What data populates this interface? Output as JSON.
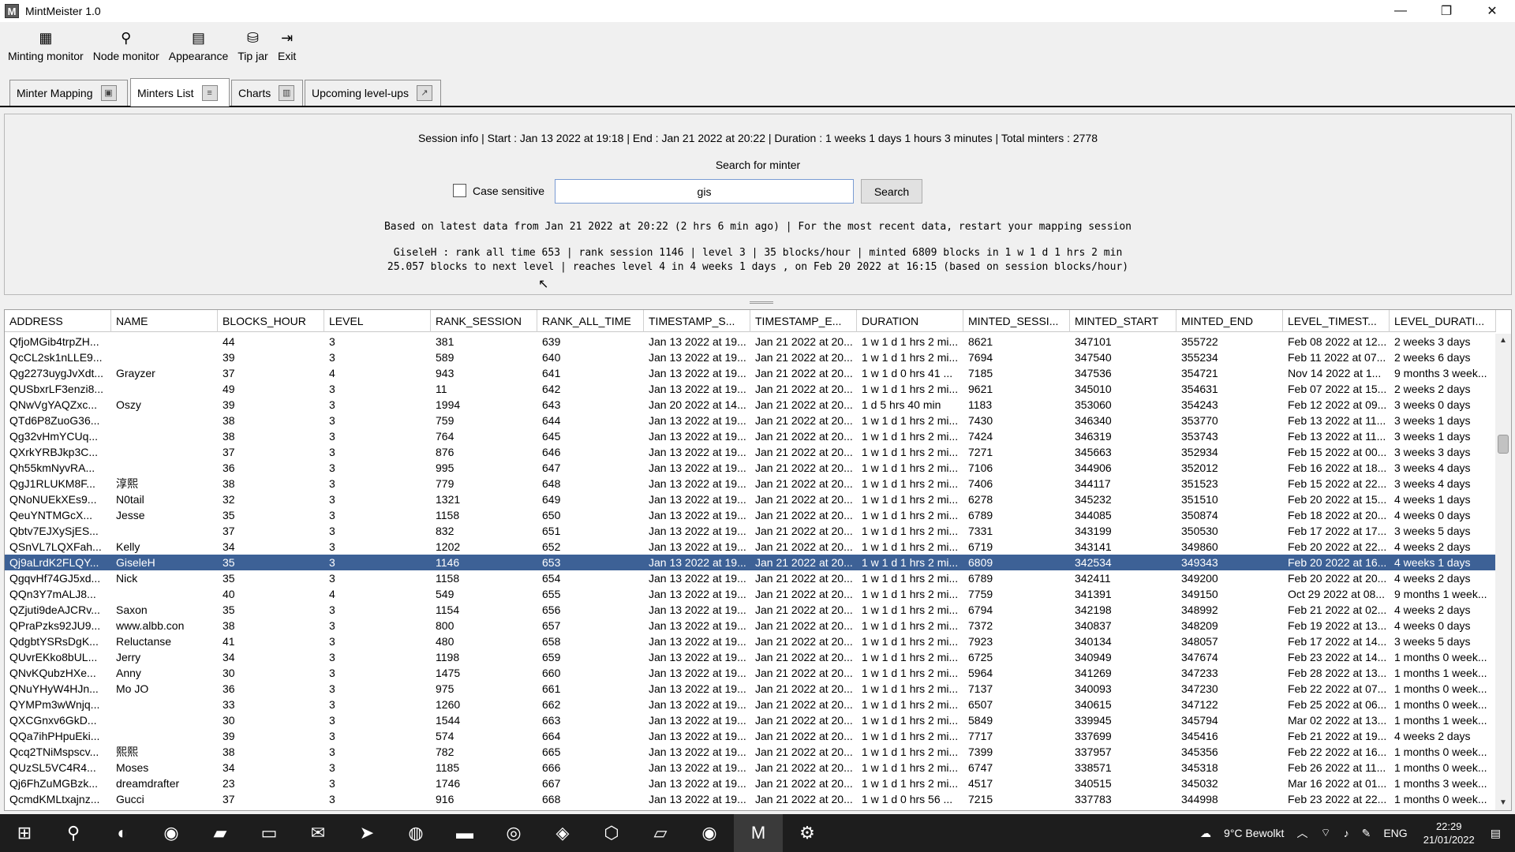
{
  "window": {
    "title": "MintMeister 1.0",
    "icon_letter": "M",
    "minimize": "—",
    "maximize": "❐",
    "close": "✕"
  },
  "toolbar": {
    "items": [
      {
        "label": "Minting monitor",
        "icon": "minting-monitor-icon",
        "glyph": "▦"
      },
      {
        "label": "Node monitor",
        "icon": "node-monitor-icon",
        "glyph": "⚲"
      },
      {
        "label": "Appearance",
        "icon": "appearance-icon",
        "glyph": "▤"
      },
      {
        "label": "Tip jar",
        "icon": "tip-jar-icon",
        "glyph": "⛁"
      },
      {
        "label": "Exit",
        "icon": "exit-icon",
        "glyph": "⇥"
      }
    ]
  },
  "tabs": [
    {
      "label": "Minter Mapping",
      "icon": "map-icon",
      "glyph": "▣",
      "active": false
    },
    {
      "label": "Minters List",
      "icon": "list-icon",
      "glyph": "≡",
      "active": true
    },
    {
      "label": "Charts",
      "icon": "chart-icon",
      "glyph": "▥",
      "active": false
    },
    {
      "label": "Upcoming level-ups",
      "icon": "level-up-icon",
      "glyph": "↗",
      "active": false
    }
  ],
  "session": {
    "info": "Session info |  Start : Jan 13 2022 at 19:18  |  End : Jan 21 2022 at 20:22  |  Duration : 1 weeks 1 days 1 hours 3 minutes  |  Total minters : 2778"
  },
  "search": {
    "title": "Search for minter",
    "case_sensitive_label": "Case sensitive",
    "value": "gis",
    "button_label": "Search"
  },
  "result": {
    "line1": "Based on latest data from Jan 21 2022 at 20:22 (2 hrs 6 min ago)  |  For the most recent data, restart your mapping session",
    "line2": "GiseleH : rank all time 653 | rank session 1146 | level 3 | 35 blocks/hour | minted 6809 blocks in 1 w 1 d 1 hrs 2 min",
    "line3": "25.057 blocks to next level | reaches level 4 in 4 weeks 1 days , on Feb 20 2022 at 16:15 (based on session blocks/hour)"
  },
  "table": {
    "columns": [
      "ADDRESS",
      "NAME",
      "BLOCKS_HOUR",
      "LEVEL",
      "RANK_SESSION",
      "RANK_ALL_TIME",
      "TIMESTAMP_S...",
      "TIMESTAMP_E...",
      "DURATION",
      "MINTED_SESSI...",
      "MINTED_START",
      "MINTED_END",
      "LEVEL_TIMEST...",
      "LEVEL_DURATI..."
    ],
    "selected_index": 14,
    "rows": [
      [
        "QfjoMGib4trpZH...",
        "",
        "44",
        "3",
        "381",
        "639",
        "Jan 13 2022 at 19...",
        "Jan 21 2022 at 20...",
        "1 w 1 d 1 hrs 2 mi...",
        "8621",
        "347101",
        "355722",
        "Feb 08 2022 at 12...",
        "2 weeks 3 days"
      ],
      [
        "QcCL2sk1nLLE9...",
        "",
        "39",
        "3",
        "589",
        "640",
        "Jan 13 2022 at 19...",
        "Jan 21 2022 at 20...",
        "1 w 1 d 1 hrs 2 mi...",
        "7694",
        "347540",
        "355234",
        "Feb 11 2022 at 07...",
        "2 weeks 6 days"
      ],
      [
        "Qg2273uygJvXdt...",
        "Grayzer",
        "37",
        "4",
        "943",
        "641",
        "Jan 13 2022 at 19...",
        "Jan 21 2022 at 20...",
        "1 w 1 d 0 hrs 41 ...",
        "7185",
        "347536",
        "354721",
        "Nov 14 2022 at 1...",
        "9 months 3 week..."
      ],
      [
        "QUSbxrLF3enzi8...",
        "",
        "49",
        "3",
        "11",
        "642",
        "Jan 13 2022 at 19...",
        "Jan 21 2022 at 20...",
        "1 w 1 d 1 hrs 2 mi...",
        "9621",
        "345010",
        "354631",
        "Feb 07 2022 at 15...",
        "2 weeks 2 days"
      ],
      [
        "QNwVgYAQZxc...",
        "Oszy",
        "39",
        "3",
        "1994",
        "643",
        "Jan 20 2022 at 14...",
        "Jan 21 2022 at 20...",
        "1 d 5 hrs 40 min",
        "1183",
        "353060",
        "354243",
        "Feb 12 2022 at 09...",
        "3 weeks 0 days"
      ],
      [
        "QTd6P8ZuoG36...",
        "",
        "38",
        "3",
        "759",
        "644",
        "Jan 13 2022 at 19...",
        "Jan 21 2022 at 20...",
        "1 w 1 d 1 hrs 2 mi...",
        "7430",
        "346340",
        "353770",
        "Feb 13 2022 at 11...",
        "3 weeks 1 days"
      ],
      [
        "Qg32vHmYCUq...",
        "",
        "38",
        "3",
        "764",
        "645",
        "Jan 13 2022 at 19...",
        "Jan 21 2022 at 20...",
        "1 w 1 d 1 hrs 2 mi...",
        "7424",
        "346319",
        "353743",
        "Feb 13 2022 at 11...",
        "3 weeks 1 days"
      ],
      [
        "QXrkYRBJkp3C...",
        "",
        "37",
        "3",
        "876",
        "646",
        "Jan 13 2022 at 19...",
        "Jan 21 2022 at 20...",
        "1 w 1 d 1 hrs 2 mi...",
        "7271",
        "345663",
        "352934",
        "Feb 15 2022 at 00...",
        "3 weeks 3 days"
      ],
      [
        "Qh55kmNyvRA...",
        "",
        "36",
        "3",
        "995",
        "647",
        "Jan 13 2022 at 19...",
        "Jan 21 2022 at 20...",
        "1 w 1 d 1 hrs 2 mi...",
        "7106",
        "344906",
        "352012",
        "Feb 16 2022 at 18...",
        "3 weeks 4 days"
      ],
      [
        "QgJ1RLUKM8F...",
        "淳熙",
        "38",
        "3",
        "779",
        "648",
        "Jan 13 2022 at 19...",
        "Jan 21 2022 at 20...",
        "1 w 1 d 1 hrs 2 mi...",
        "7406",
        "344117",
        "351523",
        "Feb 15 2022 at 22...",
        "3 weeks 4 days"
      ],
      [
        "QNoNUEkXEs9...",
        "N0tail",
        "32",
        "3",
        "1321",
        "649",
        "Jan 13 2022 at 19...",
        "Jan 21 2022 at 20...",
        "1 w 1 d 1 hrs 2 mi...",
        "6278",
        "345232",
        "351510",
        "Feb 20 2022 at 15...",
        "4 weeks 1 days"
      ],
      [
        "QeuYNTMGcX...",
        "Jesse",
        "35",
        "3",
        "1158",
        "650",
        "Jan 13 2022 at 19...",
        "Jan 21 2022 at 20...",
        "1 w 1 d 1 hrs 2 mi...",
        "6789",
        "344085",
        "350874",
        "Feb 18 2022 at 20...",
        "4 weeks 0 days"
      ],
      [
        "Qbtv7EJXySjES...",
        "",
        "37",
        "3",
        "832",
        "651",
        "Jan 13 2022 at 19...",
        "Jan 21 2022 at 20...",
        "1 w 1 d 1 hrs 2 mi...",
        "7331",
        "343199",
        "350530",
        "Feb 17 2022 at 17...",
        "3 weeks 5 days"
      ],
      [
        "QSnVL7LQXFah...",
        "Kelly",
        "34",
        "3",
        "1202",
        "652",
        "Jan 13 2022 at 19...",
        "Jan 21 2022 at 20...",
        "1 w 1 d 1 hrs 2 mi...",
        "6719",
        "343141",
        "349860",
        "Feb 20 2022 at 22...",
        "4 weeks 2 days"
      ],
      [
        "Qj9aLrdK2FLQY...",
        "GiseleH",
        "35",
        "3",
        "1146",
        "653",
        "Jan 13 2022 at 19...",
        "Jan 21 2022 at 20...",
        "1 w 1 d 1 hrs 2 mi...",
        "6809",
        "342534",
        "349343",
        "Feb 20 2022 at 16...",
        "4 weeks 1 days"
      ],
      [
        "QgqvHf74GJ5xd...",
        "Nick",
        "35",
        "3",
        "1158",
        "654",
        "Jan 13 2022 at 19...",
        "Jan 21 2022 at 20...",
        "1 w 1 d 1 hrs 2 mi...",
        "6789",
        "342411",
        "349200",
        "Feb 20 2022 at 20...",
        "4 weeks 2 days"
      ],
      [
        "QQn3Y7mALJ8...",
        "",
        "40",
        "4",
        "549",
        "655",
        "Jan 13 2022 at 19...",
        "Jan 21 2022 at 20...",
        "1 w 1 d 1 hrs 2 mi...",
        "7759",
        "341391",
        "349150",
        "Oct 29 2022 at 08...",
        "9 months 1 week..."
      ],
      [
        "QZjuti9deAJCRv...",
        "Saxon",
        "35",
        "3",
        "1154",
        "656",
        "Jan 13 2022 at 19...",
        "Jan 21 2022 at 20...",
        "1 w 1 d 1 hrs 2 mi...",
        "6794",
        "342198",
        "348992",
        "Feb 21 2022 at 02...",
        "4 weeks 2 days"
      ],
      [
        "QPraPzks92JU9...",
        "www.albb.con",
        "38",
        "3",
        "800",
        "657",
        "Jan 13 2022 at 19...",
        "Jan 21 2022 at 20...",
        "1 w 1 d 1 hrs 2 mi...",
        "7372",
        "340837",
        "348209",
        "Feb 19 2022 at 13...",
        "4 weeks 0 days"
      ],
      [
        "QdgbtYSRsDgK...",
        "Reluctanse",
        "41",
        "3",
        "480",
        "658",
        "Jan 13 2022 at 19...",
        "Jan 21 2022 at 20...",
        "1 w 1 d 1 hrs 2 mi...",
        "7923",
        "340134",
        "348057",
        "Feb 17 2022 at 14...",
        "3 weeks 5 days"
      ],
      [
        "QUvrEKko8bUL...",
        "Jerry",
        "34",
        "3",
        "1198",
        "659",
        "Jan 13 2022 at 19...",
        "Jan 21 2022 at 20...",
        "1 w 1 d 1 hrs 2 mi...",
        "6725",
        "340949",
        "347674",
        "Feb 23 2022 at 14...",
        "1 months 0 week..."
      ],
      [
        "QNvKQubzHXe...",
        "Anny",
        "30",
        "3",
        "1475",
        "660",
        "Jan 13 2022 at 19...",
        "Jan 21 2022 at 20...",
        "1 w 1 d 1 hrs 2 mi...",
        "5964",
        "341269",
        "347233",
        "Feb 28 2022 at 13...",
        "1 months 1 week..."
      ],
      [
        "QNuYHyW4HJn...",
        "Mo JO",
        "36",
        "3",
        "975",
        "661",
        "Jan 13 2022 at 19...",
        "Jan 21 2022 at 20...",
        "1 w 1 d 1 hrs 2 mi...",
        "7137",
        "340093",
        "347230",
        "Feb 22 2022 at 07...",
        "1 months 0 week..."
      ],
      [
        "QYMPm3wWnjq...",
        "",
        "33",
        "3",
        "1260",
        "662",
        "Jan 13 2022 at 19...",
        "Jan 21 2022 at 20...",
        "1 w 1 d 1 hrs 2 mi...",
        "6507",
        "340615",
        "347122",
        "Feb 25 2022 at 06...",
        "1 months 0 week..."
      ],
      [
        "QXCGnxv6GkD...",
        "",
        "30",
        "3",
        "1544",
        "663",
        "Jan 13 2022 at 19...",
        "Jan 21 2022 at 20...",
        "1 w 1 d 1 hrs 2 mi...",
        "5849",
        "339945",
        "345794",
        "Mar 02 2022 at 13...",
        "1 months 1 week..."
      ],
      [
        "QQa7ihPHpuEki...",
        "",
        "39",
        "3",
        "574",
        "664",
        "Jan 13 2022 at 19...",
        "Jan 21 2022 at 20...",
        "1 w 1 d 1 hrs 2 mi...",
        "7717",
        "337699",
        "345416",
        "Feb 21 2022 at 19...",
        "4 weeks 2 days"
      ],
      [
        "Qcq2TNiMspscv...",
        "熙熙",
        "38",
        "3",
        "782",
        "665",
        "Jan 13 2022 at 19...",
        "Jan 21 2022 at 20...",
        "1 w 1 d 1 hrs 2 mi...",
        "7399",
        "337957",
        "345356",
        "Feb 22 2022 at 16...",
        "1 months 0 week..."
      ],
      [
        "QUzSL5VC4R4...",
        "Moses",
        "34",
        "3",
        "1185",
        "666",
        "Jan 13 2022 at 19...",
        "Jan 21 2022 at 20...",
        "1 w 1 d 1 hrs 2 mi...",
        "6747",
        "338571",
        "345318",
        "Feb 26 2022 at 11...",
        "1 months 0 week..."
      ],
      [
        "Qj6FhZuMGBzk...",
        "dreamdrafter",
        "23",
        "3",
        "1746",
        "667",
        "Jan 13 2022 at 19...",
        "Jan 21 2022 at 20...",
        "1 w 1 d 1 hrs 2 mi...",
        "4517",
        "340515",
        "345032",
        "Mar 16 2022 at 01...",
        "1 months 3 week..."
      ],
      [
        "QcmdKMLtxajnz...",
        "Gucci",
        "37",
        "3",
        "916",
        "668",
        "Jan 13 2022 at 19...",
        "Jan 21 2022 at 20...",
        "1 w 1 d 0 hrs 56 ...",
        "7215",
        "337783",
        "344998",
        "Feb 23 2022 at 22...",
        "1 months 0 week..."
      ]
    ]
  },
  "taskbar": {
    "apps": [
      {
        "name": "start-icon",
        "glyph": "⊞"
      },
      {
        "name": "search-icon",
        "glyph": "⚲"
      },
      {
        "name": "edge-icon",
        "glyph": "◐"
      },
      {
        "name": "chrome-icon",
        "glyph": "◉"
      },
      {
        "name": "app-icon-1",
        "glyph": "▰"
      },
      {
        "name": "file-explorer-icon",
        "glyph": "▭"
      },
      {
        "name": "mail-icon",
        "glyph": "✉"
      },
      {
        "name": "telegram-icon",
        "glyph": "➤"
      },
      {
        "name": "spotify-icon",
        "glyph": "◍"
      },
      {
        "name": "app-icon-2",
        "glyph": "▬"
      },
      {
        "name": "steam-icon",
        "glyph": "◎"
      },
      {
        "name": "app-icon-3",
        "glyph": "◈"
      },
      {
        "name": "app-icon-4",
        "glyph": "⬡"
      },
      {
        "name": "app-icon-5",
        "glyph": "▱"
      },
      {
        "name": "chrome-icon-2",
        "glyph": "◉"
      },
      {
        "name": "mintmeister-icon",
        "glyph": "M"
      },
      {
        "name": "app-icon-6",
        "glyph": "⚙"
      }
    ],
    "weather": "9°C  Bewolkt",
    "language": "ENG",
    "time": "22:29",
    "date": "21/01/2022"
  }
}
